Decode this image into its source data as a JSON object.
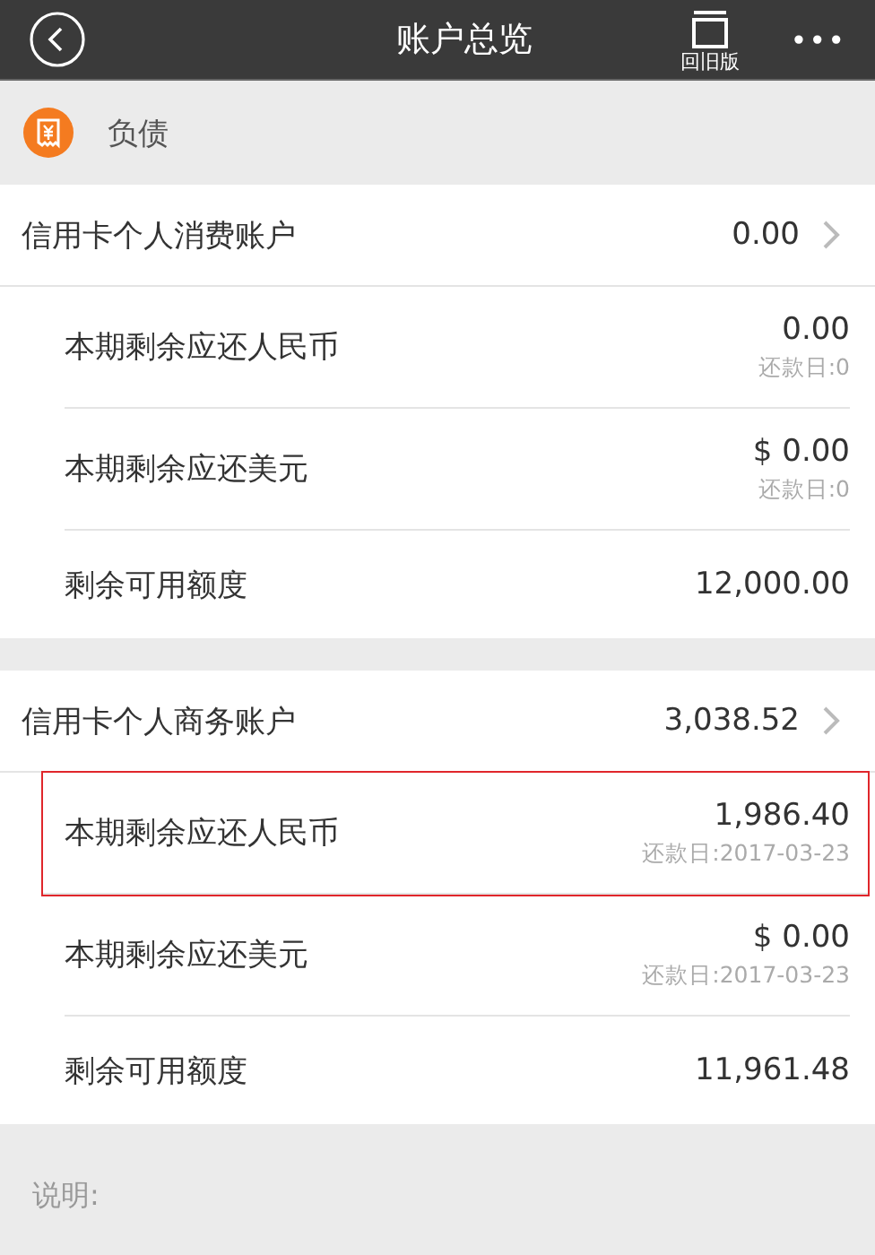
{
  "header": {
    "title": "账户总览",
    "old_version_label": "回旧版",
    "more_label": "•••"
  },
  "section": {
    "title": "负债"
  },
  "accounts": [
    {
      "name": "信用卡个人消费账户",
      "amount": "0.00",
      "rows": [
        {
          "label": "本期剩余应还人民币",
          "amount": "0.00",
          "due": "还款日:0",
          "highlighted": false
        },
        {
          "label": "本期剩余应还美元",
          "amount": "$ 0.00",
          "due": "还款日:0",
          "highlighted": false
        },
        {
          "label": "剩余可用额度",
          "amount": "12,000.00",
          "highlighted": false
        }
      ]
    },
    {
      "name": "信用卡个人商务账户",
      "amount": "3,038.52",
      "rows": [
        {
          "label": "本期剩余应还人民币",
          "amount": "1,986.40",
          "due": "还款日:2017-03-23",
          "highlighted": true
        },
        {
          "label": "本期剩余应还美元",
          "amount": "$ 0.00",
          "due": "还款日:2017-03-23",
          "highlighted": false
        },
        {
          "label": "剩余可用额度",
          "amount": "11,961.48",
          "highlighted": false
        }
      ]
    }
  ],
  "note": {
    "title": "说明:"
  }
}
